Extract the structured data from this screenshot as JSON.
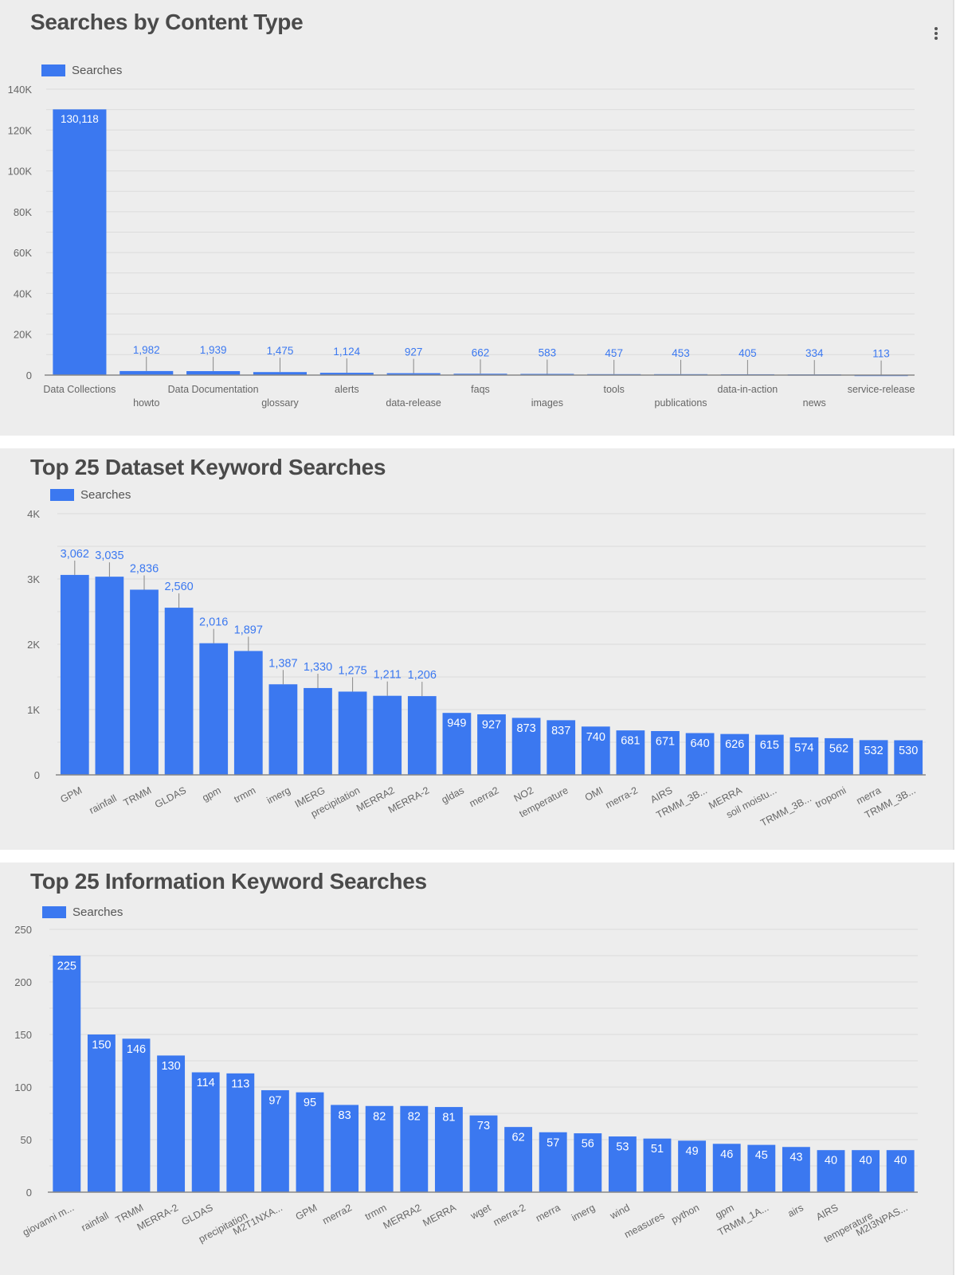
{
  "panels": [
    {
      "title": "Searches by Content Type",
      "has_menu": true,
      "menu_icon": "more-vert-icon",
      "legend": "Searches"
    },
    {
      "title": "Top 25 Dataset Keyword Searches",
      "legend": "Searches"
    },
    {
      "title": "Top 25 Information Keyword Searches",
      "legend": "Searches"
    }
  ],
  "colors": {
    "bar": "#3b78f0",
    "label_outside": "#3b78f0",
    "label_inside": "#ffffff",
    "axis_text": "#666666",
    "grid": "#dcdcdc"
  },
  "chart_data": [
    {
      "type": "bar",
      "title": "Searches by Content Type",
      "legend": [
        "Searches"
      ],
      "legend_position": "top-left",
      "xlabel": "",
      "ylabel": "",
      "ylim": [
        0,
        140000
      ],
      "yticks": [
        0,
        20000,
        40000,
        60000,
        80000,
        100000,
        120000,
        140000
      ],
      "ytick_labels": [
        "0",
        "20K",
        "40K",
        "60K",
        "80K",
        "100K",
        "120K",
        "140K"
      ],
      "grid": true,
      "categories": [
        "Data Collections",
        "howto",
        "Data Documentation",
        "glossary",
        "alerts",
        "data-release",
        "faqs",
        "images",
        "tools",
        "publications",
        "data-in-action",
        "news",
        "service-release"
      ],
      "values": [
        130118,
        1982,
        1939,
        1475,
        1124,
        927,
        662,
        583,
        457,
        453,
        405,
        334,
        113
      ],
      "value_labels": [
        "130,118",
        "1,982",
        "1,939",
        "1,475",
        "1,124",
        "927",
        "662",
        "583",
        "457",
        "453",
        "405",
        "334",
        "113"
      ],
      "x_label_layout": "staggered"
    },
    {
      "type": "bar",
      "title": "Top 25 Dataset Keyword Searches",
      "legend": [
        "Searches"
      ],
      "legend_position": "top-left",
      "xlabel": "",
      "ylabel": "",
      "ylim": [
        0,
        4000
      ],
      "yticks": [
        0,
        1000,
        2000,
        3000,
        4000
      ],
      "ytick_labels": [
        "0",
        "1K",
        "2K",
        "3K",
        "4K"
      ],
      "grid": true,
      "categories": [
        "GPM",
        "rainfall",
        "TRMM",
        "GLDAS",
        "gpm",
        "trmm",
        "imerg",
        "IMERG",
        "precipitation",
        "MERRA2",
        "MERRA-2",
        "gldas",
        "merra2",
        "NO2",
        "temperature",
        "OMI",
        "merra-2",
        "AIRS",
        "TRMM_3B...",
        "MERRA",
        "soil moistu...",
        "TRMM_3B...",
        "tropomi",
        "merra",
        "TRMM_3B..."
      ],
      "values": [
        3062,
        3035,
        2836,
        2560,
        2016,
        1897,
        1387,
        1330,
        1275,
        1211,
        1206,
        949,
        927,
        873,
        837,
        740,
        681,
        671,
        640,
        626,
        615,
        574,
        562,
        532,
        530
      ],
      "value_labels": [
        "3,062",
        "3,035",
        "2,836",
        "2,560",
        "2,016",
        "1,897",
        "1,387",
        "1,330",
        "1,275",
        "1,211",
        "1,206",
        "949",
        "927",
        "873",
        "837",
        "740",
        "681",
        "671",
        "640",
        "626",
        "615",
        "574",
        "562",
        "532",
        "530"
      ],
      "x_label_layout": "rotated"
    },
    {
      "type": "bar",
      "title": "Top 25 Information Keyword Searches",
      "legend": [
        "Searches"
      ],
      "legend_position": "top-left",
      "xlabel": "",
      "ylabel": "",
      "ylim": [
        0,
        250
      ],
      "yticks": [
        0,
        50,
        100,
        150,
        200,
        250
      ],
      "ytick_labels": [
        "0",
        "50",
        "100",
        "150",
        "200",
        "250"
      ],
      "grid": true,
      "categories": [
        "giovanni m...",
        "rainfall",
        "TRMM",
        "MERRA-2",
        "GLDAS",
        "precipitation",
        "M2T1NXA...",
        "GPM",
        "merra2",
        "trmm",
        "MERRA2",
        "MERRA",
        "wget",
        "merra-2",
        "merra",
        "imerg",
        "wind",
        "measures",
        "python",
        "gpm",
        "TRMM_1A...",
        "airs",
        "AIRS",
        "temperature",
        "M2I3NPAS..."
      ],
      "values": [
        225,
        150,
        146,
        130,
        114,
        113,
        97,
        95,
        83,
        82,
        82,
        81,
        73,
        62,
        57,
        56,
        53,
        51,
        49,
        46,
        45,
        43,
        40,
        40,
        40
      ],
      "value_labels": [
        "225",
        "150",
        "146",
        "130",
        "114",
        "113",
        "97",
        "95",
        "83",
        "82",
        "82",
        "81",
        "73",
        "62",
        "57",
        "56",
        "53",
        "51",
        "49",
        "46",
        "45",
        "43",
        "40",
        "40",
        "40"
      ],
      "x_label_layout": "rotated"
    }
  ]
}
